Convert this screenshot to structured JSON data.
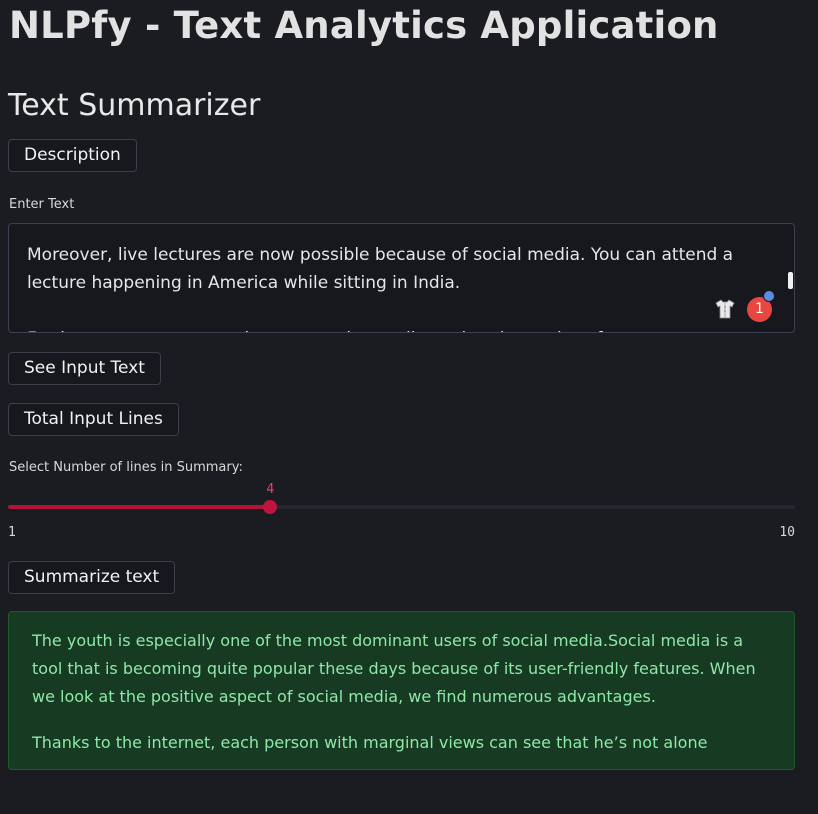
{
  "app": {
    "title": "NLPfy - Text Analytics Application",
    "section_title": "Text Summarizer"
  },
  "buttons": {
    "description": "Description",
    "see_input": "See Input Text",
    "total_lines": "Total Input Lines",
    "summarize": "Summarize text"
  },
  "input": {
    "label": "Enter Text",
    "value": "Moreover, live lectures are now possible because of social media. You can attend a lecture happening in America while sitting in India.\n\nFurthermore, as more and more people are distancing themselves from newspapers, they",
    "extension_badge": "1"
  },
  "slider": {
    "label": "Select Number of lines in Summary:",
    "value": 4,
    "min": 1,
    "max": 10,
    "value_label": "4",
    "min_label": "1",
    "max_label": "10"
  },
  "summary": {
    "paragraphs": [
      "The youth is especially one of the most dominant users of social media.Social media is a tool that is becoming quite popular these days because of its user-friendly features. When we look at the positive aspect of social media, we find numerous advantages.",
      "Thanks to the internet, each person with marginal views can see that he’s not alone"
    ]
  },
  "colors": {
    "background": "#1a1c21",
    "accent": "#b5123a",
    "success_bg": "#163a22",
    "success_text": "#8fe7a8"
  }
}
